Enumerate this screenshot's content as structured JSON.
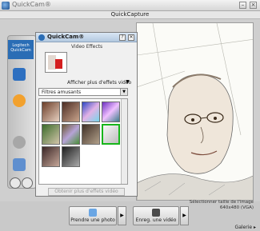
{
  "window": {
    "title": "QuickCam®"
  },
  "header": {
    "title": "QuickCapture"
  },
  "brand": {
    "line1": "Logitech",
    "line2": "QuickCam"
  },
  "panel": {
    "title": "QuickCam®",
    "help_label": "?",
    "close_label": "✕",
    "section_title": "Video Effects",
    "show_more_label": "Afficher plus d'effets vidéo",
    "filter": {
      "selected": "Filtres amusants"
    },
    "get_more_label": "Obtenir plus d'effets vidéo"
  },
  "bottom": {
    "resolution_label": "Sélectionner taille de l'image",
    "resolution_value": "640x480 (VGA)",
    "photo_button": "Prendre une photo",
    "video_button": "Enreg. une vidéo",
    "gallery_label": "Galerie"
  },
  "colors": {
    "accent": "#2a6db5",
    "selection": "#17b51b",
    "panel_title": "#b3c8df"
  },
  "icons": [
    "app-icon",
    "help-icon",
    "close-icon",
    "minimize-icon",
    "camera-icon",
    "video-icon",
    "chevron-down-icon",
    "triangle-right-icon",
    "settings-icon"
  ]
}
